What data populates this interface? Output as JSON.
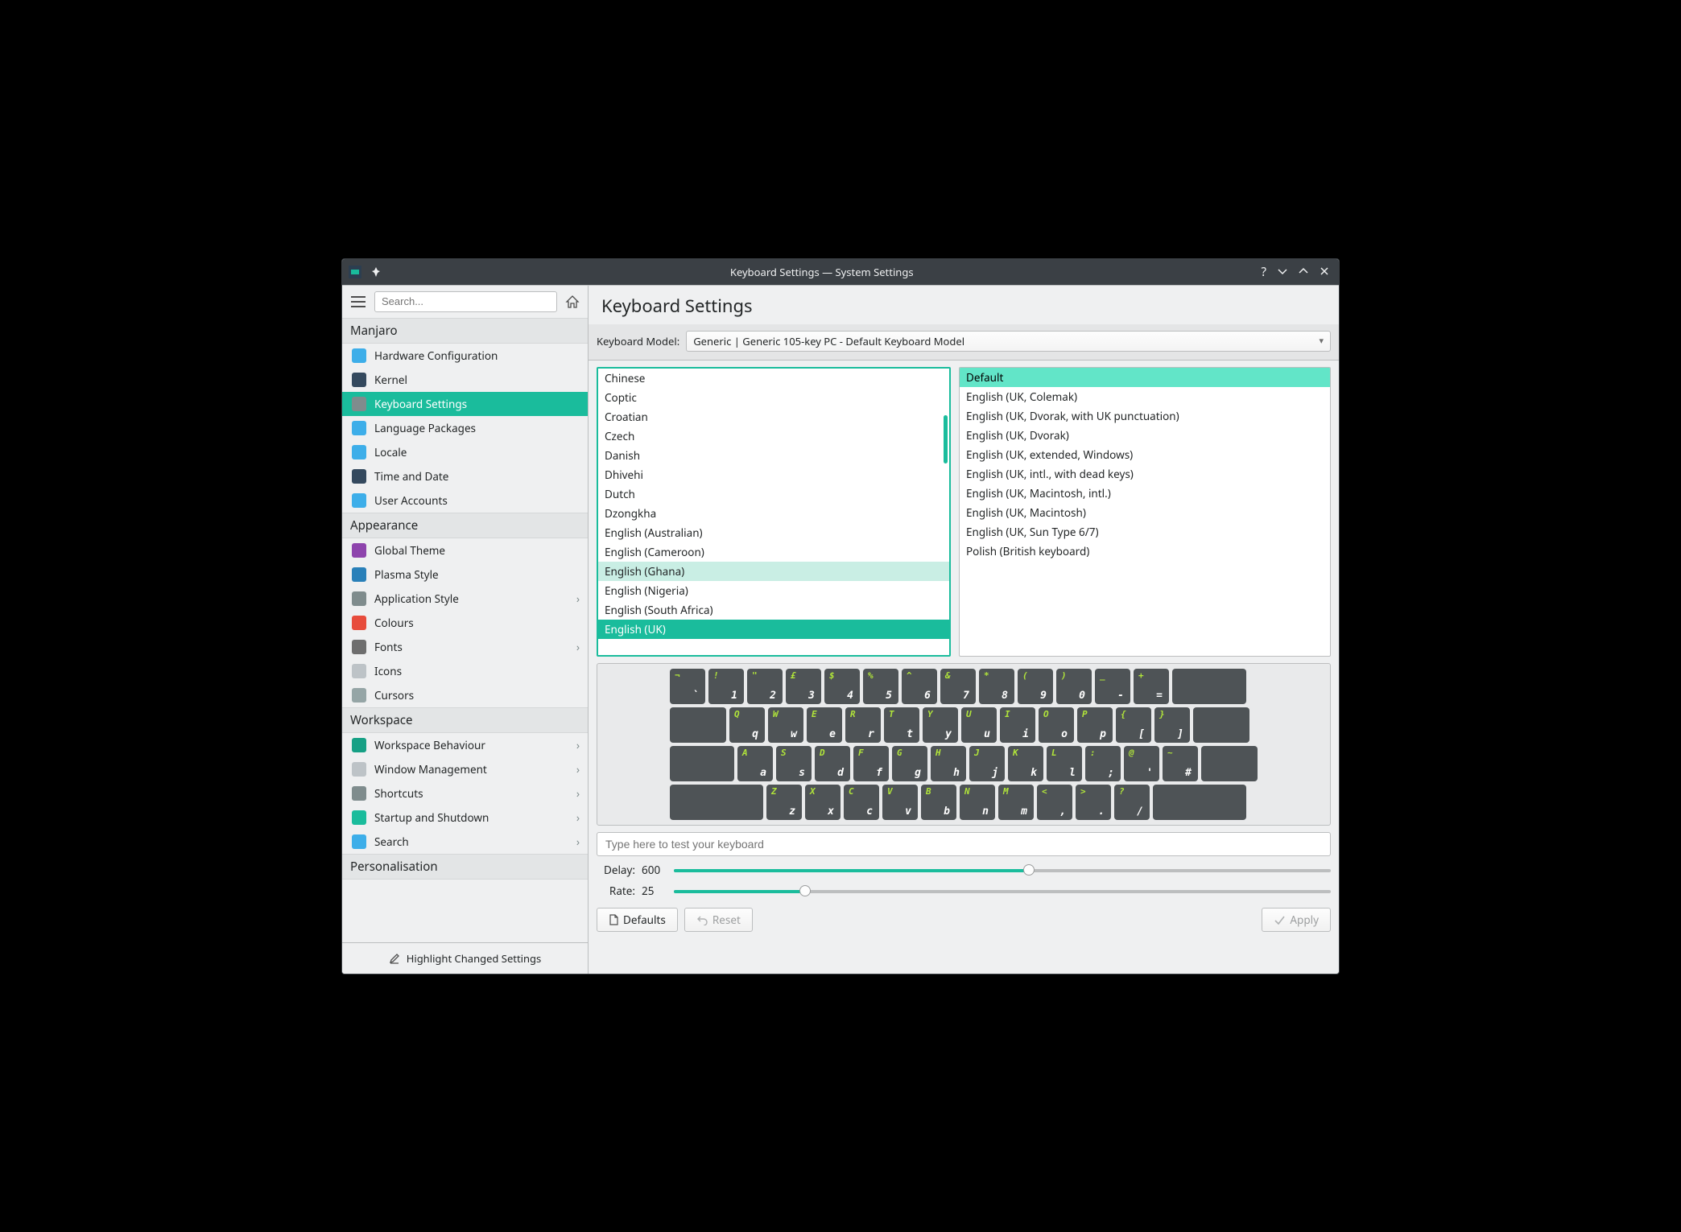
{
  "window": {
    "title": "Keyboard Settings — System Settings"
  },
  "search": {
    "placeholder": "Search..."
  },
  "sidebar": {
    "sections": [
      {
        "title": "Manjaro",
        "items": [
          {
            "label": "Hardware Configuration",
            "icon_bg": "#3daee9",
            "active": false
          },
          {
            "label": "Kernel",
            "icon_bg": "#34495e",
            "active": false
          },
          {
            "label": "Keyboard Settings",
            "icon_bg": "#7f8c8d",
            "active": true
          },
          {
            "label": "Language Packages",
            "icon_bg": "#3daee9",
            "active": false
          },
          {
            "label": "Locale",
            "icon_bg": "#3daee9",
            "active": false
          },
          {
            "label": "Time and Date",
            "icon_bg": "#34495e",
            "active": false
          },
          {
            "label": "User Accounts",
            "icon_bg": "#3daee9",
            "active": false
          }
        ]
      },
      {
        "title": "Appearance",
        "items": [
          {
            "label": "Global Theme",
            "icon_bg": "#8e44ad"
          },
          {
            "label": "Plasma Style",
            "icon_bg": "#2980b9"
          },
          {
            "label": "Application Style",
            "icon_bg": "#7f8c8d",
            "chevron": true
          },
          {
            "label": "Colours",
            "icon_bg": "#e74c3c"
          },
          {
            "label": "Fonts",
            "icon_bg": "#6e6e6e",
            "chevron": true
          },
          {
            "label": "Icons",
            "icon_bg": "#bdc3c7"
          },
          {
            "label": "Cursors",
            "icon_bg": "#95a5a6"
          }
        ]
      },
      {
        "title": "Workspace",
        "items": [
          {
            "label": "Workspace Behaviour",
            "icon_bg": "#16a085",
            "chevron": true
          },
          {
            "label": "Window Management",
            "icon_bg": "#bdc3c7",
            "chevron": true
          },
          {
            "label": "Shortcuts",
            "icon_bg": "#7f8c8d",
            "chevron": true
          },
          {
            "label": "Startup and Shutdown",
            "icon_bg": "#1abc9c",
            "chevron": true
          },
          {
            "label": "Search",
            "icon_bg": "#3daee9",
            "chevron": true
          }
        ]
      },
      {
        "title": "Personalisation",
        "items": []
      }
    ],
    "footer": "Highlight Changed Settings"
  },
  "main": {
    "title": "Keyboard Settings",
    "model_label": "Keyboard Model:",
    "model_value": "Generic | Generic 105-key PC - Default Keyboard Model",
    "layouts": [
      "Chinese",
      "Coptic",
      "Croatian",
      "Czech",
      "Danish",
      "Dhivehi",
      "Dutch",
      "Dzongkha",
      "English (Australian)",
      "English (Cameroon)",
      "English (Ghana)",
      "English (Nigeria)",
      "English (South Africa)",
      "English (UK)"
    ],
    "layouts_hover_index": 10,
    "layouts_selected_index": 13,
    "variants": [
      "Default",
      "English (UK, Colemak)",
      "English (UK, Dvorak, with UK punctuation)",
      "English (UK, Dvorak)",
      "English (UK, extended, Windows)",
      "English (UK, intl., with dead keys)",
      "English (UK, Macintosh, intl.)",
      "English (UK, Macintosh)",
      "English (UK, Sun Type 6/7)",
      "Polish (British keyboard)"
    ],
    "variants_selected_index": 0,
    "keyboard_rows": [
      [
        {
          "t": "¬",
          "b": "`",
          "w": "kw-1"
        },
        {
          "t": "!",
          "b": "1",
          "w": "kw-1"
        },
        {
          "t": "\"",
          "b": "2",
          "w": "kw-1"
        },
        {
          "t": "£",
          "b": "3",
          "w": "kw-1"
        },
        {
          "t": "$",
          "b": "4",
          "w": "kw-1"
        },
        {
          "t": "%",
          "b": "5",
          "w": "kw-1"
        },
        {
          "t": "^",
          "b": "6",
          "w": "kw-1"
        },
        {
          "t": "&",
          "b": "7",
          "w": "kw-1"
        },
        {
          "t": "*",
          "b": "8",
          "w": "kw-1"
        },
        {
          "t": "(",
          "b": "9",
          "w": "kw-1"
        },
        {
          "t": ")",
          "b": "0",
          "w": "kw-1"
        },
        {
          "t": "_",
          "b": "-",
          "w": "kw-1"
        },
        {
          "t": "+",
          "b": "=",
          "w": "kw-1"
        },
        {
          "t": "",
          "b": "",
          "w": "kw-2"
        }
      ],
      [
        {
          "t": "",
          "b": "",
          "w": "kw-15"
        },
        {
          "t": "Q",
          "b": "q",
          "w": "kw-1"
        },
        {
          "t": "W",
          "b": "w",
          "w": "kw-1"
        },
        {
          "t": "E",
          "b": "e",
          "w": "kw-1"
        },
        {
          "t": "R",
          "b": "r",
          "w": "kw-1"
        },
        {
          "t": "T",
          "b": "t",
          "w": "kw-1"
        },
        {
          "t": "Y",
          "b": "y",
          "w": "kw-1"
        },
        {
          "t": "U",
          "b": "u",
          "w": "kw-1"
        },
        {
          "t": "I",
          "b": "i",
          "w": "kw-1"
        },
        {
          "t": "O",
          "b": "o",
          "w": "kw-1"
        },
        {
          "t": "P",
          "b": "p",
          "w": "kw-1"
        },
        {
          "t": "{",
          "b": "[",
          "w": "kw-1"
        },
        {
          "t": "}",
          "b": "]",
          "w": "kw-1"
        },
        {
          "t": "",
          "b": "",
          "w": "kw-15"
        }
      ],
      [
        {
          "t": "",
          "b": "",
          "w": "kw-175"
        },
        {
          "t": "A",
          "b": "a",
          "w": "kw-1"
        },
        {
          "t": "S",
          "b": "s",
          "w": "kw-1"
        },
        {
          "t": "D",
          "b": "d",
          "w": "kw-1"
        },
        {
          "t": "F",
          "b": "f",
          "w": "kw-1"
        },
        {
          "t": "G",
          "b": "g",
          "w": "kw-1"
        },
        {
          "t": "H",
          "b": "h",
          "w": "kw-1"
        },
        {
          "t": "J",
          "b": "j",
          "w": "kw-1"
        },
        {
          "t": "K",
          "b": "k",
          "w": "kw-1"
        },
        {
          "t": "L",
          "b": "l",
          "w": "kw-1"
        },
        {
          "t": ":",
          "b": ";",
          "w": "kw-1"
        },
        {
          "t": "@",
          "b": "'",
          "w": "kw-1"
        },
        {
          "t": "~",
          "b": "#",
          "w": "kw-1"
        },
        {
          "t": "",
          "b": "",
          "w": "kw-15"
        }
      ],
      [
        {
          "t": "",
          "b": "",
          "w": "kw-big"
        },
        {
          "t": "Z",
          "b": "z",
          "w": "kw-1"
        },
        {
          "t": "X",
          "b": "x",
          "w": "kw-1"
        },
        {
          "t": "C",
          "b": "c",
          "w": "kw-1"
        },
        {
          "t": "V",
          "b": "v",
          "w": "kw-1"
        },
        {
          "t": "B",
          "b": "b",
          "w": "kw-1"
        },
        {
          "t": "N",
          "b": "n",
          "w": "kw-1"
        },
        {
          "t": "M",
          "b": "m",
          "w": "kw-1"
        },
        {
          "t": "<",
          "b": ",",
          "w": "kw-1"
        },
        {
          "t": ">",
          "b": ".",
          "w": "kw-1"
        },
        {
          "t": "?",
          "b": "/",
          "w": "kw-1"
        },
        {
          "t": "",
          "b": "",
          "w": "kw-big"
        }
      ]
    ],
    "test_placeholder": "Type here to test your keyboard",
    "delay_label": "Delay:",
    "delay_value": "600",
    "delay_fill_pct": 54,
    "rate_label": "Rate:",
    "rate_value": "25",
    "rate_fill_pct": 20,
    "buttons": {
      "defaults": "Defaults",
      "reset": "Reset",
      "apply": "Apply"
    }
  }
}
